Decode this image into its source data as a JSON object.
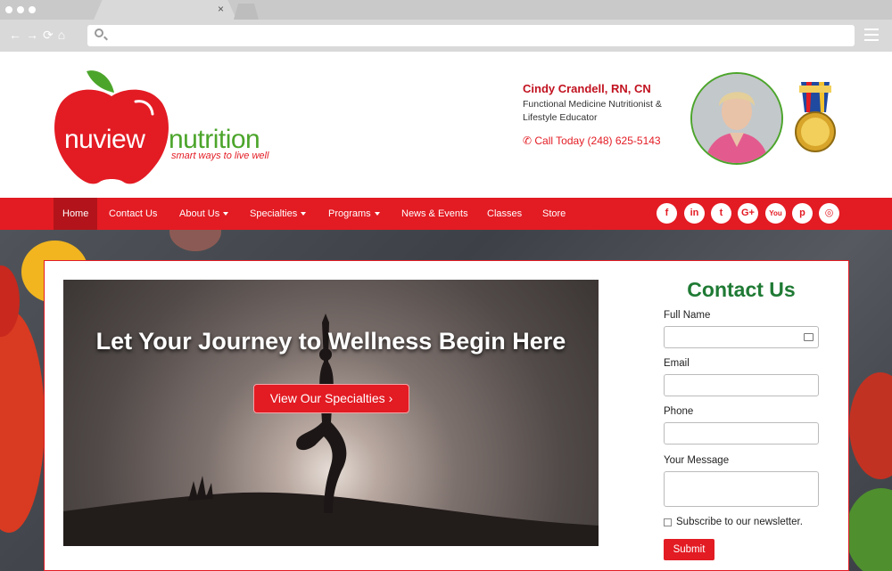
{
  "browser": {
    "tab_close": "×",
    "nav_icons": "←→⟳⌂"
  },
  "brand": {
    "logo_word1": "nuview",
    "logo_word2": "nutrition",
    "tagline": "smart ways to live well",
    "colors": {
      "primary": "#e31b23",
      "green": "#4ca52b",
      "dark_green": "#1f7a34"
    }
  },
  "person": {
    "name": "Cindy Crandell, RN, CN",
    "title": "Functional Medicine Nutritionist & Lifestyle Educator",
    "phone": "Call Today (248) 625-5143",
    "phone_icon": "phone-icon"
  },
  "nav": {
    "items": [
      {
        "label": "Home",
        "active": true
      },
      {
        "label": "Contact Us"
      },
      {
        "label": "About Us",
        "dropdown": true
      },
      {
        "label": "Specialties",
        "dropdown": true
      },
      {
        "label": "Programs",
        "dropdown": true
      },
      {
        "label": "News & Events"
      },
      {
        "label": "Classes"
      },
      {
        "label": "Store"
      }
    ],
    "social": [
      {
        "icon": "facebook-icon",
        "glyph": "f"
      },
      {
        "icon": "linkedin-icon",
        "glyph": "in"
      },
      {
        "icon": "twitter-icon",
        "glyph": "t"
      },
      {
        "icon": "google-plus-icon",
        "glyph": "G+"
      },
      {
        "icon": "youtube-icon",
        "glyph": "You"
      },
      {
        "icon": "pinterest-icon",
        "glyph": "p"
      },
      {
        "icon": "instagram-icon",
        "glyph": "◎"
      }
    ]
  },
  "hero": {
    "title": "Let Your Journey to Wellness Begin Here",
    "button": "View Our Specialties ›"
  },
  "contact": {
    "title": "Contact Us",
    "full_name_label": "Full Name",
    "email_label": "Email",
    "phone_label": "Phone",
    "message_label": "Your Message",
    "newsletter_label": "Subscribe to our newsletter.",
    "submit_label": "Submit"
  }
}
